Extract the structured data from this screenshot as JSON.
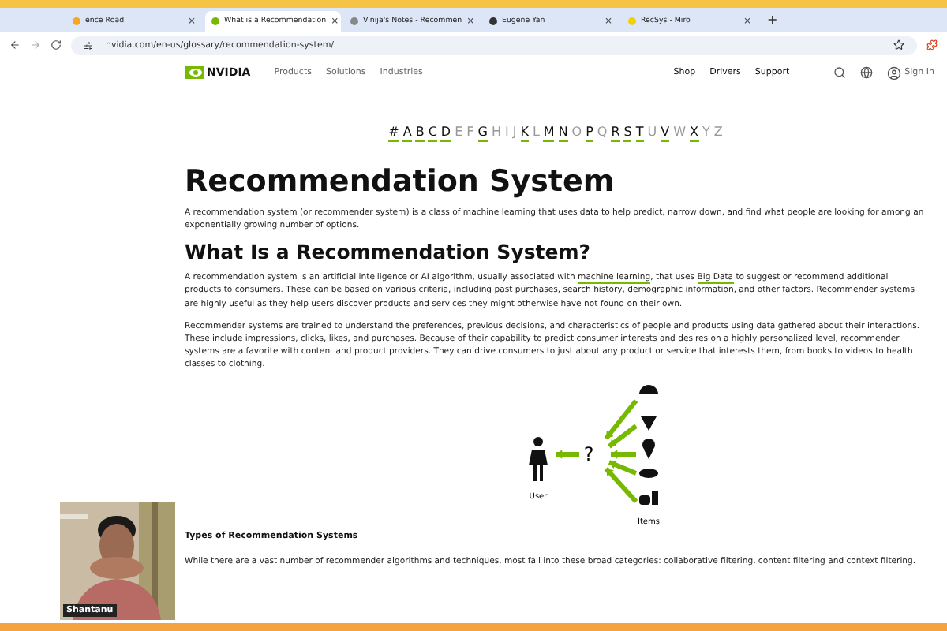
{
  "tabs": [
    {
      "title": "ence Road",
      "close": "×",
      "selected": false
    },
    {
      "title": "What is a Recommendation",
      "close": "×",
      "selected": true
    },
    {
      "title": "Vinija's Notes - Recommen",
      "close": "×",
      "selected": false
    },
    {
      "title": "Eugene Yan",
      "close": "×",
      "selected": false
    },
    {
      "title": "RecSys - Miro",
      "close": "×",
      "selected": false
    }
  ],
  "new_tab": "+",
  "address": "nvidia.com/en-us/glossary/recommendation-system/",
  "site_nav": {
    "logo": "NVIDIA",
    "left": [
      "Products",
      "Solutions",
      "Industries"
    ],
    "right": [
      "Shop",
      "Drivers",
      "Support"
    ],
    "sign_in": "Sign In"
  },
  "alphabet": [
    {
      "letter": "#",
      "active": true
    },
    {
      "letter": "A",
      "active": true
    },
    {
      "letter": "B",
      "active": true
    },
    {
      "letter": "C",
      "active": true
    },
    {
      "letter": "D",
      "active": true
    },
    {
      "letter": "E",
      "active": false
    },
    {
      "letter": "F",
      "active": false
    },
    {
      "letter": "G",
      "active": true
    },
    {
      "letter": "H",
      "active": false
    },
    {
      "letter": "I",
      "active": false
    },
    {
      "letter": "J",
      "active": false
    },
    {
      "letter": "K",
      "active": true
    },
    {
      "letter": "L",
      "active": false
    },
    {
      "letter": "M",
      "active": true
    },
    {
      "letter": "N",
      "active": true
    },
    {
      "letter": "O",
      "active": false
    },
    {
      "letter": "P",
      "active": true
    },
    {
      "letter": "Q",
      "active": false
    },
    {
      "letter": "R",
      "active": true
    },
    {
      "letter": "S",
      "active": true
    },
    {
      "letter": "T",
      "active": true
    },
    {
      "letter": "U",
      "active": false
    },
    {
      "letter": "V",
      "active": true
    },
    {
      "letter": "W",
      "active": false
    },
    {
      "letter": "X",
      "active": true
    },
    {
      "letter": "Y",
      "active": false
    },
    {
      "letter": "Z",
      "active": false
    }
  ],
  "title": "Recommendation System",
  "intro": "A recommendation system (or recommender system) is a class of machine learning that uses data to help predict, narrow down, and find what people are looking for among an exponentially growing number of options.",
  "section_heading": "What Is a Recommendation System?",
  "paragraph_1": {
    "before": "A recommendation system is an artificial intelligence or AI algorithm, usually associated with ",
    "link_1": "machine learning",
    "middle": ", that uses ",
    "link_2": "Big Data",
    "after": " to suggest or recommend additional products to consumers. These can be based on various criteria, including past purchases, search history, demographic information, and other factors. Recommender systems are highly useful as they help users discover products and services they might otherwise have not found on their own."
  },
  "paragraph_2": "Recommender systems are trained to understand the preferences, previous decisions, and characteristics of people and products using data gathered about their interactions. These include impressions, clicks, likes, and purchases. Because of their capability to predict consumer interests and desires on a highly personalized level, recommender systems are a favorite with content and product providers. They can drive consumers to just about any product or service that interests them, from books to videos to health classes to clothing.",
  "diagram": {
    "user_label": "User",
    "question": "?",
    "items_label": "Items"
  },
  "subheading": "Types of Recommendation Systems",
  "paragraph_3": "While there are a vast number of recommender algorithms and techniques, most fall into these broad categories: collaborative filtering,  content filtering and context filtering.",
  "webcam": {
    "kind": "picture",
    "name": "Shantanu"
  }
}
